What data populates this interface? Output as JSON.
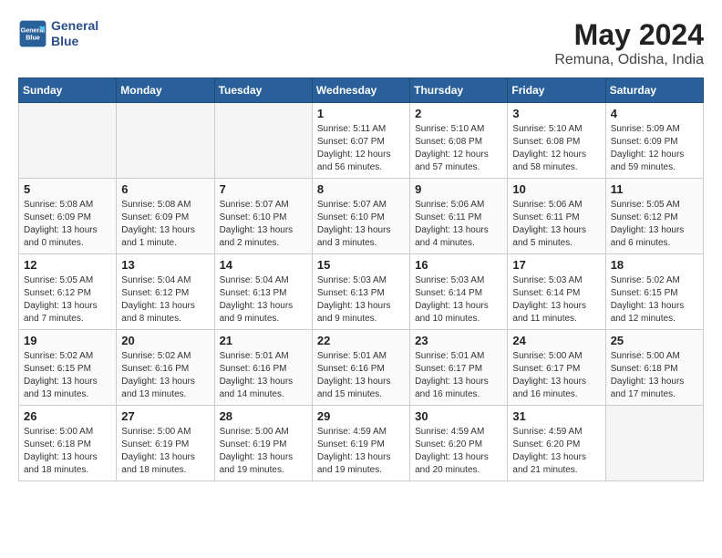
{
  "header": {
    "logo_line1": "General",
    "logo_line2": "Blue",
    "month_year": "May 2024",
    "location": "Remuna, Odisha, India"
  },
  "weekdays": [
    "Sunday",
    "Monday",
    "Tuesday",
    "Wednesday",
    "Thursday",
    "Friday",
    "Saturday"
  ],
  "weeks": [
    [
      {
        "day": "",
        "sunrise": "",
        "sunset": "",
        "daylight": ""
      },
      {
        "day": "",
        "sunrise": "",
        "sunset": "",
        "daylight": ""
      },
      {
        "day": "",
        "sunrise": "",
        "sunset": "",
        "daylight": ""
      },
      {
        "day": "1",
        "sunrise": "5:11 AM",
        "sunset": "6:07 PM",
        "daylight": "12 hours and 56 minutes."
      },
      {
        "day": "2",
        "sunrise": "5:10 AM",
        "sunset": "6:08 PM",
        "daylight": "12 hours and 57 minutes."
      },
      {
        "day": "3",
        "sunrise": "5:10 AM",
        "sunset": "6:08 PM",
        "daylight": "12 hours and 58 minutes."
      },
      {
        "day": "4",
        "sunrise": "5:09 AM",
        "sunset": "6:09 PM",
        "daylight": "12 hours and 59 minutes."
      }
    ],
    [
      {
        "day": "5",
        "sunrise": "5:08 AM",
        "sunset": "6:09 PM",
        "daylight": "13 hours and 0 minutes."
      },
      {
        "day": "6",
        "sunrise": "5:08 AM",
        "sunset": "6:09 PM",
        "daylight": "13 hours and 1 minute."
      },
      {
        "day": "7",
        "sunrise": "5:07 AM",
        "sunset": "6:10 PM",
        "daylight": "13 hours and 2 minutes."
      },
      {
        "day": "8",
        "sunrise": "5:07 AM",
        "sunset": "6:10 PM",
        "daylight": "13 hours and 3 minutes."
      },
      {
        "day": "9",
        "sunrise": "5:06 AM",
        "sunset": "6:11 PM",
        "daylight": "13 hours and 4 minutes."
      },
      {
        "day": "10",
        "sunrise": "5:06 AM",
        "sunset": "6:11 PM",
        "daylight": "13 hours and 5 minutes."
      },
      {
        "day": "11",
        "sunrise": "5:05 AM",
        "sunset": "6:12 PM",
        "daylight": "13 hours and 6 minutes."
      }
    ],
    [
      {
        "day": "12",
        "sunrise": "5:05 AM",
        "sunset": "6:12 PM",
        "daylight": "13 hours and 7 minutes."
      },
      {
        "day": "13",
        "sunrise": "5:04 AM",
        "sunset": "6:12 PM",
        "daylight": "13 hours and 8 minutes."
      },
      {
        "day": "14",
        "sunrise": "5:04 AM",
        "sunset": "6:13 PM",
        "daylight": "13 hours and 9 minutes."
      },
      {
        "day": "15",
        "sunrise": "5:03 AM",
        "sunset": "6:13 PM",
        "daylight": "13 hours and 9 minutes."
      },
      {
        "day": "16",
        "sunrise": "5:03 AM",
        "sunset": "6:14 PM",
        "daylight": "13 hours and 10 minutes."
      },
      {
        "day": "17",
        "sunrise": "5:03 AM",
        "sunset": "6:14 PM",
        "daylight": "13 hours and 11 minutes."
      },
      {
        "day": "18",
        "sunrise": "5:02 AM",
        "sunset": "6:15 PM",
        "daylight": "13 hours and 12 minutes."
      }
    ],
    [
      {
        "day": "19",
        "sunrise": "5:02 AM",
        "sunset": "6:15 PM",
        "daylight": "13 hours and 13 minutes."
      },
      {
        "day": "20",
        "sunrise": "5:02 AM",
        "sunset": "6:16 PM",
        "daylight": "13 hours and 13 minutes."
      },
      {
        "day": "21",
        "sunrise": "5:01 AM",
        "sunset": "6:16 PM",
        "daylight": "13 hours and 14 minutes."
      },
      {
        "day": "22",
        "sunrise": "5:01 AM",
        "sunset": "6:16 PM",
        "daylight": "13 hours and 15 minutes."
      },
      {
        "day": "23",
        "sunrise": "5:01 AM",
        "sunset": "6:17 PM",
        "daylight": "13 hours and 16 minutes."
      },
      {
        "day": "24",
        "sunrise": "5:00 AM",
        "sunset": "6:17 PM",
        "daylight": "13 hours and 16 minutes."
      },
      {
        "day": "25",
        "sunrise": "5:00 AM",
        "sunset": "6:18 PM",
        "daylight": "13 hours and 17 minutes."
      }
    ],
    [
      {
        "day": "26",
        "sunrise": "5:00 AM",
        "sunset": "6:18 PM",
        "daylight": "13 hours and 18 minutes."
      },
      {
        "day": "27",
        "sunrise": "5:00 AM",
        "sunset": "6:19 PM",
        "daylight": "13 hours and 18 minutes."
      },
      {
        "day": "28",
        "sunrise": "5:00 AM",
        "sunset": "6:19 PM",
        "daylight": "13 hours and 19 minutes."
      },
      {
        "day": "29",
        "sunrise": "4:59 AM",
        "sunset": "6:19 PM",
        "daylight": "13 hours and 19 minutes."
      },
      {
        "day": "30",
        "sunrise": "4:59 AM",
        "sunset": "6:20 PM",
        "daylight": "13 hours and 20 minutes."
      },
      {
        "day": "31",
        "sunrise": "4:59 AM",
        "sunset": "6:20 PM",
        "daylight": "13 hours and 21 minutes."
      },
      {
        "day": "",
        "sunrise": "",
        "sunset": "",
        "daylight": ""
      }
    ]
  ]
}
